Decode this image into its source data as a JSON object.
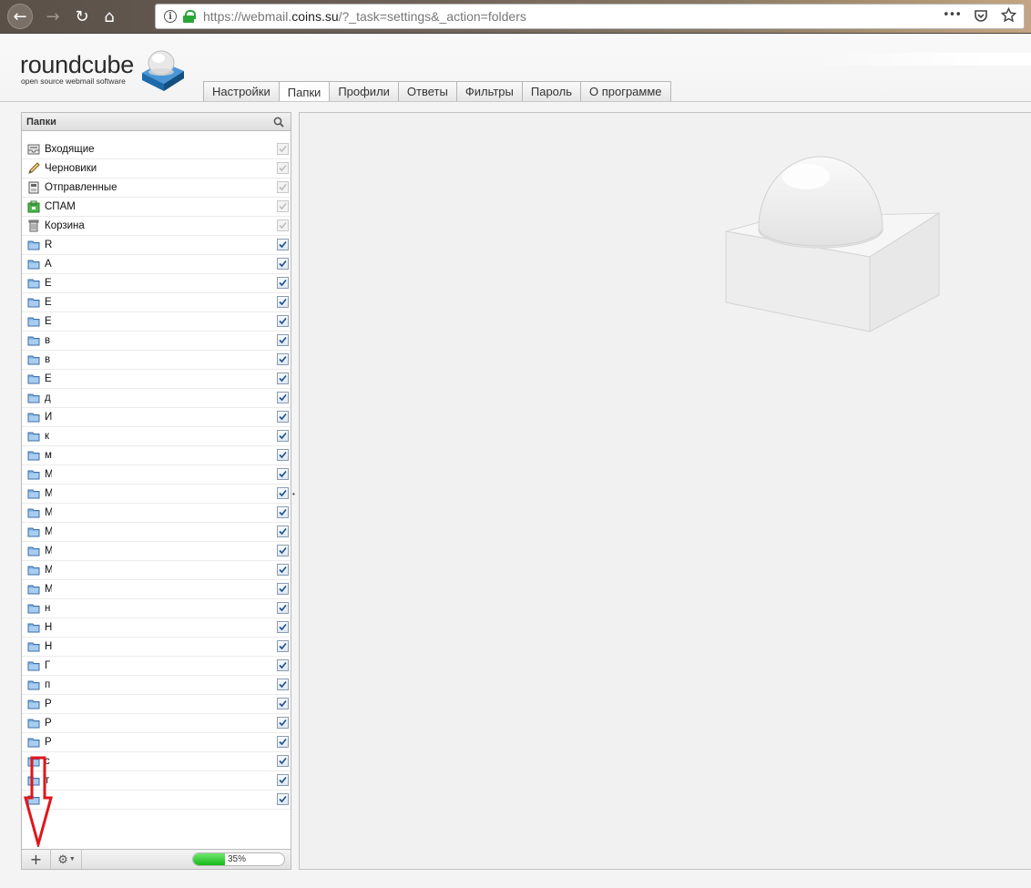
{
  "browser": {
    "url_prefix": "https://webmail.",
    "url_domain": "coins.su",
    "url_suffix": "/?_task=settings&_action=folders",
    "menu_glyph": "•••"
  },
  "app": {
    "logo_text": "roundcube",
    "logo_subtitle": "open source webmail software"
  },
  "tabs": [
    {
      "label": "Настройки",
      "active": false
    },
    {
      "label": "Папки",
      "active": true
    },
    {
      "label": "Профили",
      "active": false
    },
    {
      "label": "Ответы",
      "active": false
    },
    {
      "label": "Фильтры",
      "active": false
    },
    {
      "label": "Пароль",
      "active": false
    },
    {
      "label": "О программе",
      "active": false
    }
  ],
  "folder_panel": {
    "title": "Папки",
    "system_folders": [
      {
        "name": "Входящие",
        "icon": "inbox-icon"
      },
      {
        "name": "Черновики",
        "icon": "drafts-icon"
      },
      {
        "name": "Отправленные",
        "icon": "sent-icon"
      },
      {
        "name": "СПАМ",
        "icon": "spam-icon"
      },
      {
        "name": "Корзина",
        "icon": "trash-icon"
      }
    ],
    "user_folders": [
      "R",
      "A",
      "E",
      "E",
      "E",
      "в",
      "в",
      "E",
      "д",
      "И",
      "к",
      "м",
      "M",
      "M",
      "M",
      "M",
      "M",
      "M",
      "M",
      "н",
      "H",
      "H",
      "Г",
      "п",
      "P",
      "P",
      "P",
      "с",
      "т",
      ""
    ],
    "quota": {
      "label": "35%",
      "percent": 35
    }
  },
  "colors": {
    "accent_green": "#18b818",
    "arrow_red": "#e0161b"
  }
}
